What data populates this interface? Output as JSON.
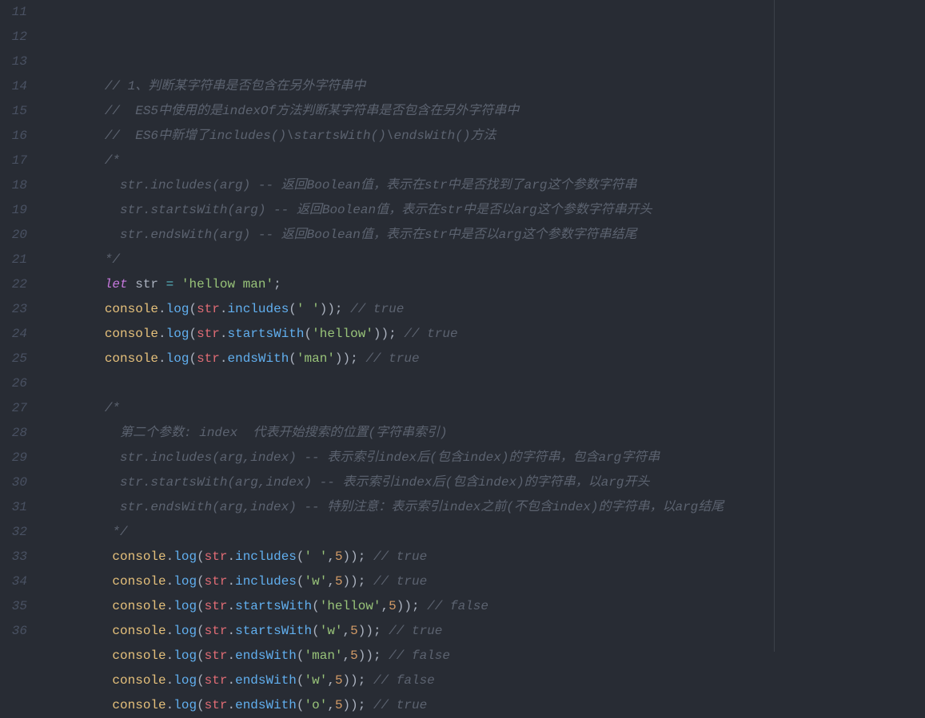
{
  "lines": [
    {
      "num": "11",
      "indent": "        ",
      "tokens": [
        {
          "cls": "comment",
          "text": "// 1、判断某字符串是否包含在另外字符串中"
        }
      ]
    },
    {
      "num": "12",
      "indent": "        ",
      "tokens": [
        {
          "cls": "comment",
          "text": "//  ES5中使用的是indexOf方法判断某字符串是否包含在另外字符串中"
        }
      ]
    },
    {
      "num": "13",
      "indent": "        ",
      "tokens": [
        {
          "cls": "comment",
          "text": "//  ES6中新增了includes()\\startsWith()\\endsWith()方法"
        }
      ]
    },
    {
      "num": "14",
      "indent": "        ",
      "tokens": [
        {
          "cls": "comment",
          "text": "/*"
        }
      ]
    },
    {
      "num": "15",
      "indent": "          ",
      "tokens": [
        {
          "cls": "comment",
          "text": "str.includes(arg) -- 返回Boolean值，表示在str中是否找到了arg这个参数字符串"
        }
      ]
    },
    {
      "num": "16",
      "indent": "          ",
      "tokens": [
        {
          "cls": "comment",
          "text": "str.startsWith(arg) -- 返回Boolean值，表示在str中是否以arg这个参数字符串开头"
        }
      ]
    },
    {
      "num": "17",
      "indent": "          ",
      "tokens": [
        {
          "cls": "comment",
          "text": "str.endsWith(arg) -- 返回Boolean值，表示在str中是否以arg这个参数字符串结尾"
        }
      ]
    },
    {
      "num": "18",
      "indent": "        ",
      "tokens": [
        {
          "cls": "comment",
          "text": "*/"
        }
      ]
    },
    {
      "num": "19",
      "indent": "        ",
      "tokens": [
        {
          "cls": "keyword",
          "text": "let"
        },
        {
          "cls": "punct",
          "text": " str "
        },
        {
          "cls": "operator",
          "text": "="
        },
        {
          "cls": "punct",
          "text": " "
        },
        {
          "cls": "string",
          "text": "'hellow man'"
        },
        {
          "cls": "punct",
          "text": ";"
        }
      ]
    },
    {
      "num": "20",
      "indent": "        ",
      "tokens": [
        {
          "cls": "property",
          "text": "console"
        },
        {
          "cls": "punct",
          "text": "."
        },
        {
          "cls": "method",
          "text": "log"
        },
        {
          "cls": "punct",
          "text": "("
        },
        {
          "cls": "variable",
          "text": "str"
        },
        {
          "cls": "punct",
          "text": "."
        },
        {
          "cls": "method",
          "text": "includes"
        },
        {
          "cls": "punct",
          "text": "("
        },
        {
          "cls": "string",
          "text": "' '"
        },
        {
          "cls": "punct",
          "text": ")); "
        },
        {
          "cls": "comment",
          "text": "// true"
        }
      ]
    },
    {
      "num": "21",
      "indent": "        ",
      "tokens": [
        {
          "cls": "property",
          "text": "console"
        },
        {
          "cls": "punct",
          "text": "."
        },
        {
          "cls": "method",
          "text": "log"
        },
        {
          "cls": "punct",
          "text": "("
        },
        {
          "cls": "variable",
          "text": "str"
        },
        {
          "cls": "punct",
          "text": "."
        },
        {
          "cls": "method",
          "text": "startsWith"
        },
        {
          "cls": "punct",
          "text": "("
        },
        {
          "cls": "string",
          "text": "'hellow'"
        },
        {
          "cls": "punct",
          "text": ")); "
        },
        {
          "cls": "comment",
          "text": "// true"
        }
      ]
    },
    {
      "num": "22",
      "indent": "        ",
      "tokens": [
        {
          "cls": "property",
          "text": "console"
        },
        {
          "cls": "punct",
          "text": "."
        },
        {
          "cls": "method",
          "text": "log"
        },
        {
          "cls": "punct",
          "text": "("
        },
        {
          "cls": "variable",
          "text": "str"
        },
        {
          "cls": "punct",
          "text": "."
        },
        {
          "cls": "method",
          "text": "endsWith"
        },
        {
          "cls": "punct",
          "text": "("
        },
        {
          "cls": "string",
          "text": "'man'"
        },
        {
          "cls": "punct",
          "text": ")); "
        },
        {
          "cls": "comment",
          "text": "// true"
        }
      ]
    },
    {
      "num": "23",
      "indent": "",
      "tokens": []
    },
    {
      "num": "24",
      "indent": "        ",
      "tokens": [
        {
          "cls": "comment",
          "text": "/*"
        }
      ]
    },
    {
      "num": "25",
      "indent": "          ",
      "tokens": [
        {
          "cls": "comment",
          "text": "第二个参数: index  代表开始搜索的位置(字符串索引)"
        }
      ]
    },
    {
      "num": "26",
      "indent": "          ",
      "tokens": [
        {
          "cls": "comment",
          "text": "str.includes(arg,index) -- 表示索引index后(包含index)的字符串，包含arg字符串"
        }
      ]
    },
    {
      "num": "27",
      "indent": "          ",
      "tokens": [
        {
          "cls": "comment",
          "text": "str.startsWith(arg,index) -- 表示索引index后(包含index)的字符串，以arg开头"
        }
      ]
    },
    {
      "num": "28",
      "indent": "          ",
      "tokens": [
        {
          "cls": "comment",
          "text": "str.endsWith(arg,index) -- 特别注意：表示索引index之前(不包含index)的字符串，以arg结尾"
        }
      ]
    },
    {
      "num": "29",
      "indent": "         ",
      "tokens": [
        {
          "cls": "comment",
          "text": "*/"
        }
      ]
    },
    {
      "num": "30",
      "indent": "         ",
      "tokens": [
        {
          "cls": "property",
          "text": "console"
        },
        {
          "cls": "punct",
          "text": "."
        },
        {
          "cls": "method",
          "text": "log"
        },
        {
          "cls": "punct",
          "text": "("
        },
        {
          "cls": "variable",
          "text": "str"
        },
        {
          "cls": "punct",
          "text": "."
        },
        {
          "cls": "method",
          "text": "includes"
        },
        {
          "cls": "punct",
          "text": "("
        },
        {
          "cls": "string",
          "text": "' '"
        },
        {
          "cls": "punct",
          "text": ","
        },
        {
          "cls": "number",
          "text": "5"
        },
        {
          "cls": "punct",
          "text": ")); "
        },
        {
          "cls": "comment",
          "text": "// true"
        }
      ]
    },
    {
      "num": "31",
      "indent": "         ",
      "tokens": [
        {
          "cls": "property",
          "text": "console"
        },
        {
          "cls": "punct",
          "text": "."
        },
        {
          "cls": "method",
          "text": "log"
        },
        {
          "cls": "punct",
          "text": "("
        },
        {
          "cls": "variable",
          "text": "str"
        },
        {
          "cls": "punct",
          "text": "."
        },
        {
          "cls": "method",
          "text": "includes"
        },
        {
          "cls": "punct",
          "text": "("
        },
        {
          "cls": "string",
          "text": "'w'"
        },
        {
          "cls": "punct",
          "text": ","
        },
        {
          "cls": "number",
          "text": "5"
        },
        {
          "cls": "punct",
          "text": ")); "
        },
        {
          "cls": "comment",
          "text": "// true"
        }
      ]
    },
    {
      "num": "32",
      "indent": "         ",
      "tokens": [
        {
          "cls": "property",
          "text": "console"
        },
        {
          "cls": "punct",
          "text": "."
        },
        {
          "cls": "method",
          "text": "log"
        },
        {
          "cls": "punct",
          "text": "("
        },
        {
          "cls": "variable",
          "text": "str"
        },
        {
          "cls": "punct",
          "text": "."
        },
        {
          "cls": "method",
          "text": "startsWith"
        },
        {
          "cls": "punct",
          "text": "("
        },
        {
          "cls": "string",
          "text": "'hellow'"
        },
        {
          "cls": "punct",
          "text": ","
        },
        {
          "cls": "number",
          "text": "5"
        },
        {
          "cls": "punct",
          "text": ")); "
        },
        {
          "cls": "comment",
          "text": "// false"
        }
      ]
    },
    {
      "num": "33",
      "indent": "         ",
      "tokens": [
        {
          "cls": "property",
          "text": "console"
        },
        {
          "cls": "punct",
          "text": "."
        },
        {
          "cls": "method",
          "text": "log"
        },
        {
          "cls": "punct",
          "text": "("
        },
        {
          "cls": "variable",
          "text": "str"
        },
        {
          "cls": "punct",
          "text": "."
        },
        {
          "cls": "method",
          "text": "startsWith"
        },
        {
          "cls": "punct",
          "text": "("
        },
        {
          "cls": "string",
          "text": "'w'"
        },
        {
          "cls": "punct",
          "text": ","
        },
        {
          "cls": "number",
          "text": "5"
        },
        {
          "cls": "punct",
          "text": ")); "
        },
        {
          "cls": "comment",
          "text": "// true"
        }
      ]
    },
    {
      "num": "34",
      "indent": "         ",
      "tokens": [
        {
          "cls": "property",
          "text": "console"
        },
        {
          "cls": "punct",
          "text": "."
        },
        {
          "cls": "method",
          "text": "log"
        },
        {
          "cls": "punct",
          "text": "("
        },
        {
          "cls": "variable",
          "text": "str"
        },
        {
          "cls": "punct",
          "text": "."
        },
        {
          "cls": "method",
          "text": "endsWith"
        },
        {
          "cls": "punct",
          "text": "("
        },
        {
          "cls": "string",
          "text": "'man'"
        },
        {
          "cls": "punct",
          "text": ","
        },
        {
          "cls": "number",
          "text": "5"
        },
        {
          "cls": "punct",
          "text": ")); "
        },
        {
          "cls": "comment",
          "text": "// false"
        }
      ]
    },
    {
      "num": "35",
      "indent": "         ",
      "tokens": [
        {
          "cls": "property",
          "text": "console"
        },
        {
          "cls": "punct",
          "text": "."
        },
        {
          "cls": "method",
          "text": "log"
        },
        {
          "cls": "punct",
          "text": "("
        },
        {
          "cls": "variable",
          "text": "str"
        },
        {
          "cls": "punct",
          "text": "."
        },
        {
          "cls": "method",
          "text": "endsWith"
        },
        {
          "cls": "punct",
          "text": "("
        },
        {
          "cls": "string",
          "text": "'w'"
        },
        {
          "cls": "punct",
          "text": ","
        },
        {
          "cls": "number",
          "text": "5"
        },
        {
          "cls": "punct",
          "text": ")); "
        },
        {
          "cls": "comment",
          "text": "// false"
        }
      ]
    },
    {
      "num": "36",
      "indent": "         ",
      "tokens": [
        {
          "cls": "property",
          "text": "console"
        },
        {
          "cls": "punct",
          "text": "."
        },
        {
          "cls": "method",
          "text": "log"
        },
        {
          "cls": "punct",
          "text": "("
        },
        {
          "cls": "variable",
          "text": "str"
        },
        {
          "cls": "punct",
          "text": "."
        },
        {
          "cls": "method",
          "text": "endsWith"
        },
        {
          "cls": "punct",
          "text": "("
        },
        {
          "cls": "string",
          "text": "'o'"
        },
        {
          "cls": "punct",
          "text": ","
        },
        {
          "cls": "number",
          "text": "5"
        },
        {
          "cls": "punct",
          "text": ")); "
        },
        {
          "cls": "comment",
          "text": "// true"
        }
      ]
    }
  ]
}
